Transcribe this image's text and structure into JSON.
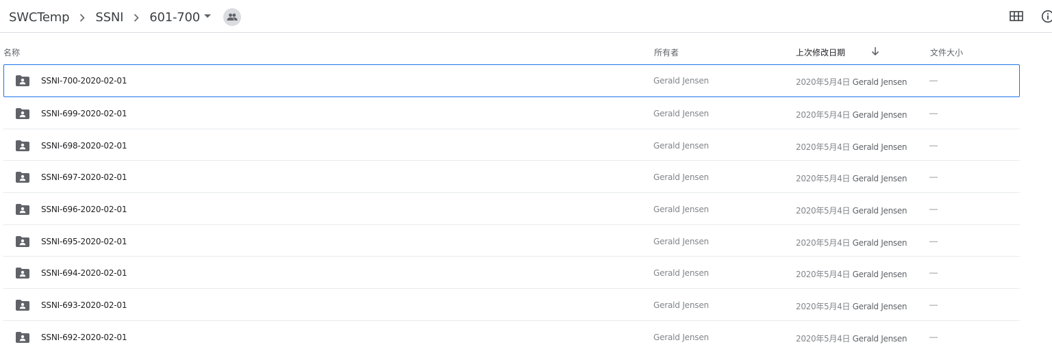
{
  "breadcrumb": {
    "items": [
      "SWCTemp",
      "SSNI",
      "601-700"
    ]
  },
  "header": {
    "name": "名称",
    "owner": "所有者",
    "modified": "上次修改日期",
    "size": "文件大小"
  },
  "rows": [
    {
      "name": "SSNI-700-2020-02-01",
      "owner": "Gerald Jensen",
      "date": "2020年5月4日",
      "by": "Gerald Jensen",
      "size": "—"
    },
    {
      "name": "SSNI-699-2020-02-01",
      "owner": "Gerald Jensen",
      "date": "2020年5月4日",
      "by": "Gerald Jensen",
      "size": "—"
    },
    {
      "name": "SSNI-698-2020-02-01",
      "owner": "Gerald Jensen",
      "date": "2020年5月4日",
      "by": "Gerald Jensen",
      "size": "—"
    },
    {
      "name": "SSNI-697-2020-02-01",
      "owner": "Gerald Jensen",
      "date": "2020年5月4日",
      "by": "Gerald Jensen",
      "size": "—"
    },
    {
      "name": "SSNI-696-2020-02-01",
      "owner": "Gerald Jensen",
      "date": "2020年5月4日",
      "by": "Gerald Jensen",
      "size": "—"
    },
    {
      "name": "SSNI-695-2020-02-01",
      "owner": "Gerald Jensen",
      "date": "2020年5月4日",
      "by": "Gerald Jensen",
      "size": "—"
    },
    {
      "name": "SSNI-694-2020-02-01",
      "owner": "Gerald Jensen",
      "date": "2020年5月4日",
      "by": "Gerald Jensen",
      "size": "—"
    },
    {
      "name": "SSNI-693-2020-02-01",
      "owner": "Gerald Jensen",
      "date": "2020年5月4日",
      "by": "Gerald Jensen",
      "size": "—"
    },
    {
      "name": "SSNI-692-2020-02-01",
      "owner": "Gerald Jensen",
      "date": "2020年5月4日",
      "by": "Gerald Jensen",
      "size": "—"
    }
  ],
  "icons": {
    "folder": "shared-folder-icon",
    "sort": "arrow-down-icon",
    "grid": "grid-view-icon",
    "info": "info-icon",
    "shared": "people-icon",
    "dropdown": "dropdown-arrow-icon"
  },
  "colors": {
    "selection_border": "#1a73e8",
    "folder_icon": "#5f6368",
    "divider": "#e8eaed"
  }
}
